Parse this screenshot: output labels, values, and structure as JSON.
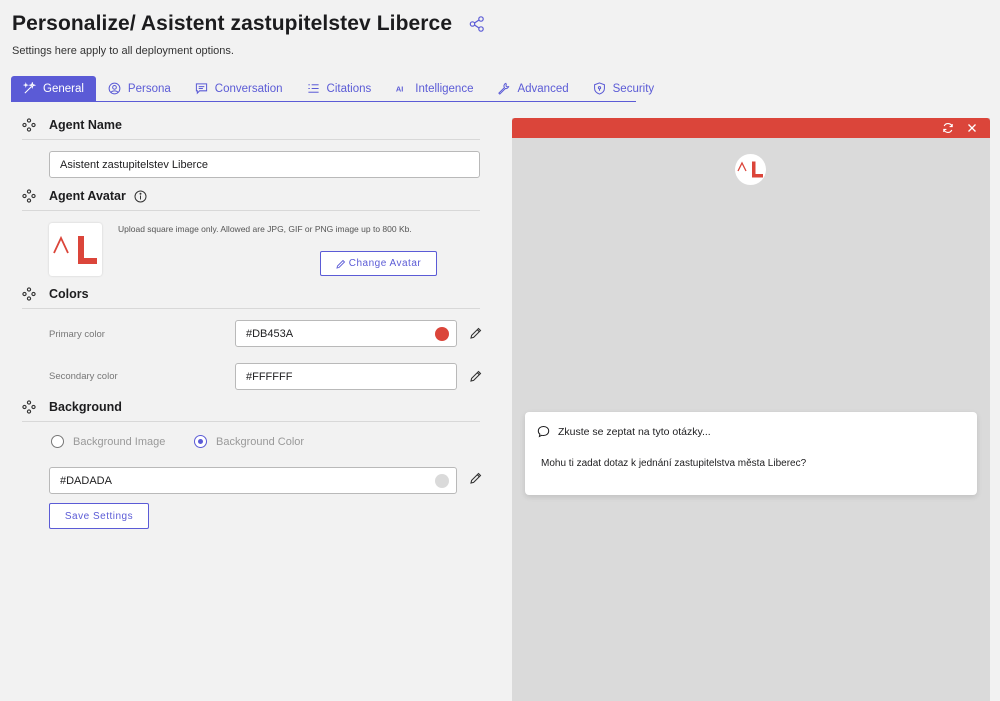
{
  "header": {
    "title": "Personalize/ Asistent zastupitelstev Liberce",
    "subtitle": "Settings here apply to all deployment options."
  },
  "tabs": [
    {
      "label": "General",
      "icon": "wand-icon",
      "active": true
    },
    {
      "label": "Persona",
      "icon": "user-circle-icon",
      "active": false
    },
    {
      "label": "Conversation",
      "icon": "chat-icon",
      "active": false
    },
    {
      "label": "Citations",
      "icon": "list-icon",
      "active": false
    },
    {
      "label": "Intelligence",
      "icon": "ai-icon",
      "active": false
    },
    {
      "label": "Advanced",
      "icon": "wrench-icon",
      "active": false
    },
    {
      "label": "Security",
      "icon": "shield-icon",
      "active": false
    }
  ],
  "agent_name": {
    "section_title": "Agent Name",
    "value": "Asistent zastupitelstev Liberce"
  },
  "agent_avatar": {
    "section_title": "Agent Avatar",
    "upload_hint": "Upload square image only. Allowed are JPG, GIF or PNG image up to 800 Kb.",
    "change_button": "Change Avatar"
  },
  "colors": {
    "section_title": "Colors",
    "primary_label": "Primary color",
    "primary_value": "#DB453A",
    "secondary_label": "Secondary color",
    "secondary_value": "#FFFFFF"
  },
  "background": {
    "section_title": "Background",
    "option_image": "Background Image",
    "option_color": "Background Color",
    "selected": "Background Color",
    "color_value": "#DADADA"
  },
  "save_button": "Save Settings",
  "preview": {
    "suggest_title": "Zkuste se zeptat na tyto otázky...",
    "suggest_question": "Mohu ti zadat dotaz k jednání zastupitelstva města Liberec?",
    "accent_color": "#DB453A",
    "background_color": "#DADADA"
  },
  "theme": {
    "brand_color": "#5B5BD6"
  }
}
